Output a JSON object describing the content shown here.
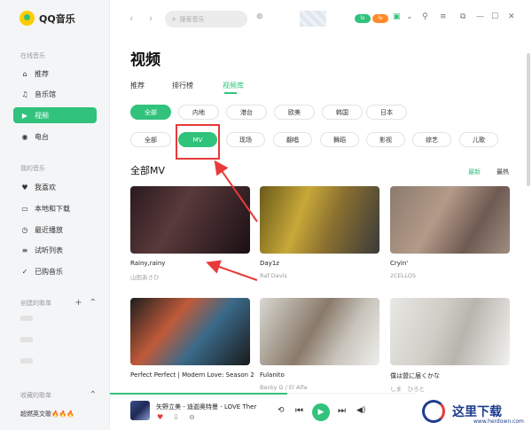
{
  "app": {
    "name": "QQ音乐"
  },
  "sidebar": {
    "online_title": "在线音乐",
    "online_items": [
      {
        "label": "推荐",
        "icon": "home-icon"
      },
      {
        "label": "音乐馆",
        "icon": "music-note-icon"
      },
      {
        "label": "视频",
        "icon": "video-icon",
        "active": true
      },
      {
        "label": "电台",
        "icon": "radio-icon"
      }
    ],
    "mine_title": "我的音乐",
    "mine_items": [
      {
        "label": "我喜欢",
        "icon": "heart-icon"
      },
      {
        "label": "本地和下载",
        "icon": "monitor-icon"
      },
      {
        "label": "最近播放",
        "icon": "clock-icon"
      },
      {
        "label": "试听列表",
        "icon": "list-icon"
      },
      {
        "label": "已购音乐",
        "icon": "check-circle-icon"
      }
    ],
    "created_title": "创建的歌单",
    "collected_title": "收藏的歌单",
    "collected_playlist": "超燃英文歌🔥🔥🔥"
  },
  "topbar": {
    "search_placeholder": "搜索音乐",
    "badge_green": "lv",
    "badge_orange": "lv"
  },
  "page": {
    "title": "视频",
    "tabs": [
      {
        "label": "推荐"
      },
      {
        "label": "排行榜"
      },
      {
        "label": "视频库",
        "active": true
      }
    ],
    "region_filters": [
      "全部",
      "内地",
      "港台",
      "欧美",
      "韩国",
      "日本"
    ],
    "type_filters": [
      "全部",
      "MV",
      "现场",
      "翻唱",
      "舞蹈",
      "影视",
      "综艺",
      "儿歌"
    ],
    "section_title": "全部MV",
    "sort": {
      "newest": "最新",
      "hottest": "最热"
    }
  },
  "mvs": [
    {
      "title": "Rainy,rainy",
      "artist": "山田あさひ"
    },
    {
      "title": "Day1z",
      "artist": "Raf Davis"
    },
    {
      "title": "Cryin'",
      "artist": "2CELLOS"
    },
    {
      "title": "Perfect Perfect | Modern Love: Season 2",
      "artist": ""
    },
    {
      "title": "Fulanito",
      "artist": "Becky G / El Alfa"
    },
    {
      "title": "僕は盟に届くかな",
      "artist": "しま　ひろと"
    }
  ],
  "player": {
    "now_playing": "矢野立美 - 迪迦奥特曼 - LOVE Ther"
  },
  "watermark": {
    "text": "这里下载",
    "sub": "www.herdown.com"
  },
  "colors": {
    "accent": "#31c27c",
    "annotation": "#e83a3a"
  }
}
